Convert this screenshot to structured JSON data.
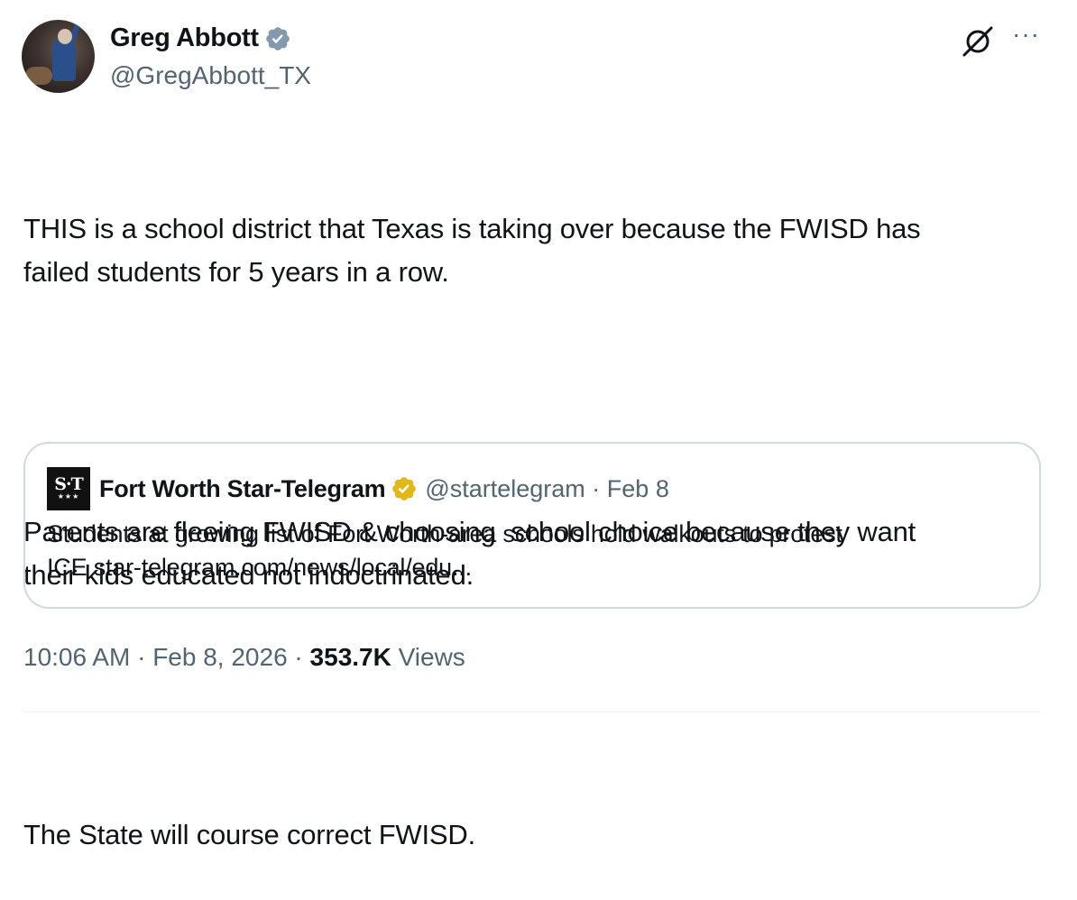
{
  "author": {
    "display_name": "Greg Abbott",
    "handle": "@GregAbbott_TX",
    "verified_color": "#829aab"
  },
  "toolbar": {
    "grok_icon": "grok-icon",
    "more_label": "···"
  },
  "tweet": {
    "paragraphs": [
      "THIS is a school district that Texas is taking over because the FWISD has\nfailed students for 5 years in a row.",
      "Parents are fleeing FWISD & choosing  school choice because they want\ntheir kids educated not indoctrinated.",
      "The State will course correct FWISD."
    ]
  },
  "quote": {
    "logo_text": "S·T",
    "logo_stars": "★★★",
    "name": "Fort Worth Star-Telegram",
    "verified_color": "#e2b719",
    "handle_date": "@startelegram · Feb 8",
    "text": "Students at growing list of Fort Worth-area schools hold walkouts to protest\nICE star-telegram.com/news/local/edu..."
  },
  "meta": {
    "time": "10:06 AM",
    "date": "Feb 8, 2026",
    "separator": " · ",
    "views_count": "353.7K",
    "views_label": " Views"
  }
}
